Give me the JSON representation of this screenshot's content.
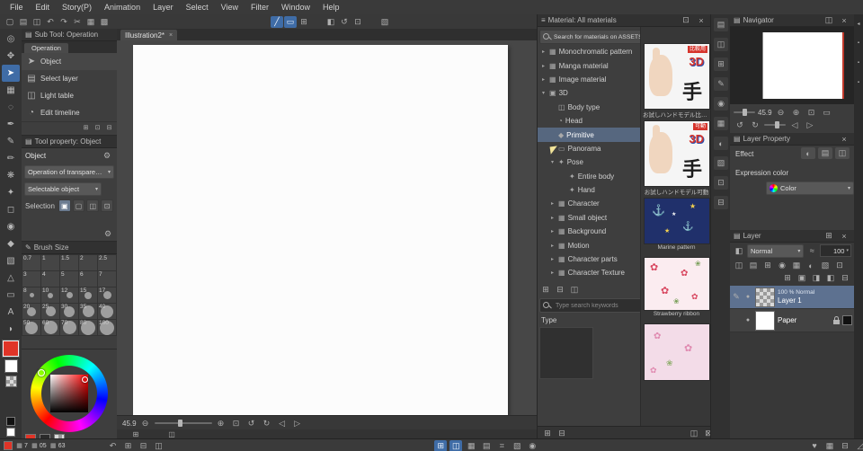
{
  "menubar": {
    "items": [
      "File",
      "Edit",
      "Story(P)",
      "Animation",
      "Layer",
      "Select",
      "View",
      "Filter",
      "Window",
      "Help"
    ]
  },
  "canvas": {
    "tab_label": "Illustration2*",
    "zoom_value": "45.9"
  },
  "subtool": {
    "title": "Sub Tool: Operation",
    "group_tab": "Operation",
    "items": [
      "Object",
      "Select layer",
      "Light table",
      "Edit timeline"
    ]
  },
  "tool_property": {
    "title": "Tool property: Object",
    "tool_name": "Object",
    "dropdown_transparent": "Operation of transparent part",
    "dropdown_selectable": "Selectable object",
    "selection_label": "Selection"
  },
  "brush_size": {
    "title": "Brush Size",
    "sizes": [
      "0.7",
      "1",
      "1.5",
      "2",
      "2.5",
      "3",
      "4",
      "5",
      "6",
      "7",
      "8",
      "10",
      "12",
      "15",
      "17",
      "20",
      "25",
      "30",
      "35",
      "40",
      "50",
      "60",
      "70",
      "80",
      "100"
    ]
  },
  "material": {
    "title": "Material: All materials",
    "search_button_label": "Search for materials on ASSETS",
    "search_placeholder": "Type search keywords",
    "type_label": "Type",
    "tree": [
      "Monochromatic pattern",
      "Manga material",
      "Image material",
      "3D",
      "Body type",
      "Head",
      "Primitive",
      "Panorama",
      "Pose",
      "Entire body",
      "Hand",
      "Character",
      "Small object",
      "Background",
      "Motion",
      "Character parts",
      "Character Texture"
    ],
    "thumbs": [
      {
        "badge": "比較用",
        "logo": "3D",
        "kanji": "手",
        "caption": "お試しハンドモデル比較用"
      },
      {
        "badge": "可動",
        "logo": "3D",
        "kanji": "手",
        "caption": "お試しハンドモデル可動"
      },
      {
        "caption": "Marine pattern"
      },
      {
        "caption": "Strawberry ribbon"
      },
      {
        "caption": ""
      }
    ]
  },
  "navigator": {
    "title": "Navigator",
    "zoom_value": "45.9"
  },
  "layer_property": {
    "title": "Layer Property",
    "effect_label": "Effect",
    "expression_label": "Expression color",
    "expression_value": "Color"
  },
  "layer_panel": {
    "title": "Layer",
    "blend_mode": "Normal",
    "opacity_value": "100",
    "layers": [
      {
        "meta": "100 % Normal",
        "name": "Layer 1"
      },
      {
        "meta": "",
        "name": "Paper"
      }
    ]
  },
  "statusbar": {
    "stats": [
      "7",
      "05",
      "63"
    ]
  }
}
